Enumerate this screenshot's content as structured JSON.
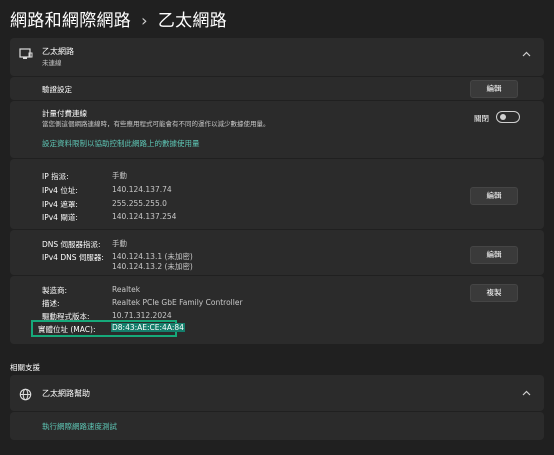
{
  "breadcrumb": {
    "parent": "網路和網際網路",
    "separator": "›",
    "current": "乙太網路"
  },
  "ethernet_card": {
    "title": "乙太網路",
    "status": "未連線"
  },
  "auth": {
    "label": "驗證設定",
    "button": "編輯"
  },
  "metered": {
    "title": "計量付費連線",
    "description": "當您側這個網路連線時，有些應用程式可能會有不同的運作以減少數據使用量。",
    "toggle_label": "關閉",
    "toggle_state": "off"
  },
  "data_limit_link": "設定資料限制以協助控制此網路上的數據使用量",
  "ip": {
    "rows": [
      {
        "label": "IP 指派:",
        "value": "手動"
      },
      {
        "label": "IPv4 位址:",
        "value": "140.124.137.74"
      },
      {
        "label": "IPv4 遮罩:",
        "value": "255.255.255.0"
      },
      {
        "label": "IPv4 閘道:",
        "value": "140.124.137.254"
      }
    ],
    "button": "編輯"
  },
  "dns": {
    "assign_label": "DNS 伺服器指派:",
    "assign_value": "手動",
    "servers_label": "IPv4 DNS 伺服器:",
    "servers": [
      "140.124.13.1 (未加密)",
      "140.124.13.2 (未加密)"
    ],
    "button": "編輯"
  },
  "hardware": {
    "rows": [
      {
        "label": "製造商:",
        "value": "Realtek"
      },
      {
        "label": "描述:",
        "value": "Realtek PCIe GbE Family Controller"
      },
      {
        "label": "驅動程式版本:",
        "value": "10.71.312.2024"
      }
    ],
    "mac_label": "實體位址 (MAC):",
    "mac_value": "D8:43:AE:CE:4A:84",
    "button": "複製"
  },
  "related": {
    "heading": "相關支援",
    "help_title": "乙太網路幫助",
    "help_link": "執行網際網路速度測試"
  },
  "colors": {
    "accent": "#5ec6b5",
    "highlight_border": "#16a97a",
    "background": "#202020",
    "card": "#2b2b2b"
  },
  "icons": {
    "ethernet": "ethernet-monitor-icon",
    "globe": "globe-icon",
    "chevron": "chevron-up-icon"
  }
}
